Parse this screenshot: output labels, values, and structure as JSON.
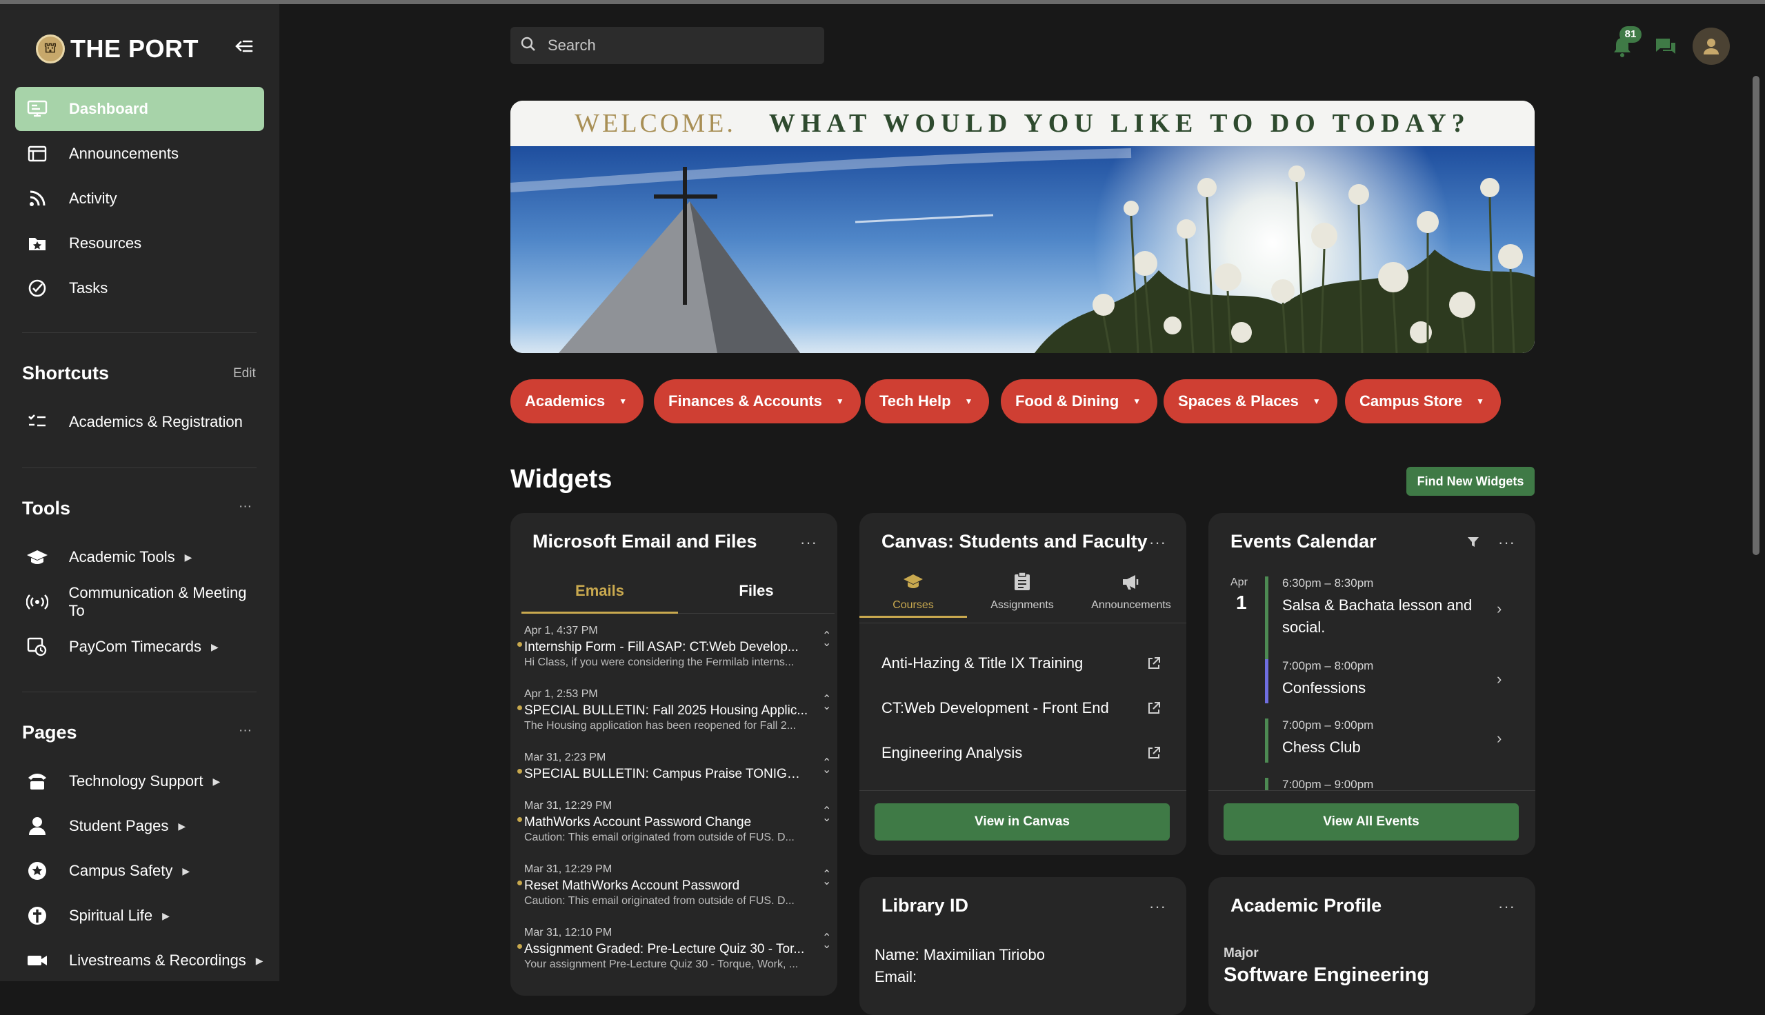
{
  "brand": {
    "name": "THE PORT"
  },
  "nav": [
    {
      "label": "Dashboard"
    },
    {
      "label": "Announcements"
    },
    {
      "label": "Activity"
    },
    {
      "label": "Resources"
    },
    {
      "label": "Tasks"
    }
  ],
  "shortcuts": {
    "title": "Shortcuts",
    "edit": "Edit",
    "items": [
      {
        "label": "Academics & Registration"
      }
    ]
  },
  "tools": {
    "title": "Tools",
    "more": "···",
    "items": [
      {
        "label": "Academic Tools"
      },
      {
        "label": "Communication & Meeting To"
      },
      {
        "label": "PayCom Timecards"
      }
    ]
  },
  "pages": {
    "title": "Pages",
    "more": "···",
    "items": [
      {
        "label": "Technology Support"
      },
      {
        "label": "Student Pages"
      },
      {
        "label": "Campus Safety"
      },
      {
        "label": "Spiritual Life"
      },
      {
        "label": "Livestreams & Recordings"
      }
    ]
  },
  "search": {
    "placeholder": "Search"
  },
  "notifications": {
    "count": "81"
  },
  "banner": {
    "welcome": "WELCOME.",
    "headline": "WHAT WOULD YOU LIKE TO DO TODAY?"
  },
  "quick_links": [
    {
      "label": "Academics"
    },
    {
      "label": "Finances & Accounts"
    },
    {
      "label": "Tech Help"
    },
    {
      "label": "Food & Dining"
    },
    {
      "label": "Spaces & Places"
    },
    {
      "label": "Campus Store"
    }
  ],
  "widgets": {
    "title": "Widgets",
    "find_button": "Find New Widgets"
  },
  "email_widget": {
    "title": "Microsoft Email and Files",
    "tabs": [
      "Emails",
      "Files"
    ],
    "emails": [
      {
        "date": "Apr 1, 4:37 PM",
        "subject": "Internship Form - Fill ASAP: CT:Web Develop...",
        "preview": "Hi Class, if you were considering the Fermilab interns..."
      },
      {
        "date": "Apr 1, 2:53 PM",
        "subject": "SPECIAL BULLETIN: Fall 2025 Housing Applic...",
        "preview": "The Housing application has been reopened for Fall 2..."
      },
      {
        "date": "Mar 31, 2:23 PM",
        "subject": "SPECIAL BULLETIN: Campus Praise TONIGHT...",
        "preview": ""
      },
      {
        "date": "Mar 31, 12:29 PM",
        "subject": "MathWorks Account Password Change",
        "preview": "Caution: This email originated from outside of FUS. D..."
      },
      {
        "date": "Mar 31, 12:29 PM",
        "subject": "Reset MathWorks Account Password",
        "preview": "Caution: This email originated from outside of FUS. D..."
      },
      {
        "date": "Mar 31, 12:10 PM",
        "subject": "Assignment Graded: Pre-Lecture Quiz 30 - Tor...",
        "preview": "Your assignment Pre-Lecture Quiz 30 - Torque, Work, ..."
      }
    ]
  },
  "canvas_widget": {
    "title": "Canvas: Students and Faculty",
    "tabs": [
      "Courses",
      "Assignments",
      "Announcements"
    ],
    "courses": [
      "Anti-Hazing & Title IX Training",
      "CT:Web Development - Front End",
      "Engineering Analysis"
    ],
    "button": "View in Canvas"
  },
  "events_widget": {
    "title": "Events Calendar",
    "month": "Apr",
    "day": "1",
    "events": [
      {
        "time": "6:30pm – 8:30pm",
        "name": "Salsa & Bachata lesson and social.",
        "color": "#4d8a53"
      },
      {
        "time": "7:00pm – 8:00pm",
        "name": "Confessions",
        "color": "#6f6ee0"
      },
      {
        "time": "7:00pm – 9:00pm",
        "name": "Chess Club",
        "color": "#4d8a53"
      },
      {
        "time": "7:00pm – 9:00pm",
        "name": "",
        "color": "#4d8a53"
      }
    ],
    "button": "View All Events"
  },
  "library_widget": {
    "title": "Library ID",
    "name_line": "Name: Maximilian Tiriobo",
    "email_line": "Email:"
  },
  "academic_widget": {
    "title": "Academic Profile",
    "major_label": "Major",
    "major_value": "Software Engineering"
  },
  "colors": {
    "accent_green": "#3f7a46",
    "active_nav": "#a7d3a9",
    "quick_link_red": "#cf3f33",
    "gold": "#c7a84d"
  }
}
